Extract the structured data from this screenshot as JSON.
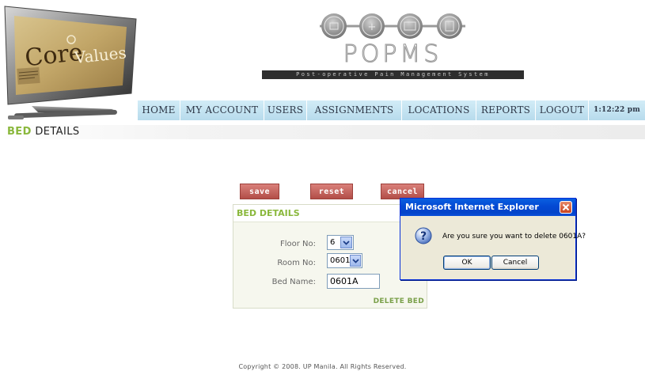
{
  "logo": {
    "core_values_text": "Core Values",
    "app_name": "POPMS",
    "app_subtitle": "Post-operative Pain Management System"
  },
  "nav": {
    "items": [
      {
        "label": "HOME"
      },
      {
        "label": "MY ACCOUNT"
      },
      {
        "label": "USERS"
      },
      {
        "label": "ASSIGNMENTS"
      },
      {
        "label": "LOCATIONS"
      },
      {
        "label": "REPORTS"
      },
      {
        "label": "LOGOUT"
      }
    ],
    "clock": "1:12:22 pm"
  },
  "page": {
    "title_first": "BED",
    "title_second": "DETAILS"
  },
  "actions": {
    "save": "save",
    "reset": "reset",
    "cancel": "cancel"
  },
  "form": {
    "title": "BED DETAILS",
    "floor_label": "Floor No:",
    "floor_value": "6",
    "room_label": "Room No:",
    "room_value": "0601",
    "bed_label": "Bed Name:",
    "bed_value": "0601A",
    "delete_label": "DELETE BED"
  },
  "dialog": {
    "title": "Microsoft Internet Explorer",
    "message": "Are you sure you want to delete 0601A?",
    "ok_label": "OK",
    "cancel_label": "Cancel"
  },
  "footer": {
    "text": "Copyright © 2008. UP Manila. All Rights Reserved."
  },
  "colors": {
    "nav_bg": "#bfe1f0",
    "heading_accent": "#8ab83c",
    "action_button": "#c0605a",
    "dialog_title": "#0349d3"
  }
}
